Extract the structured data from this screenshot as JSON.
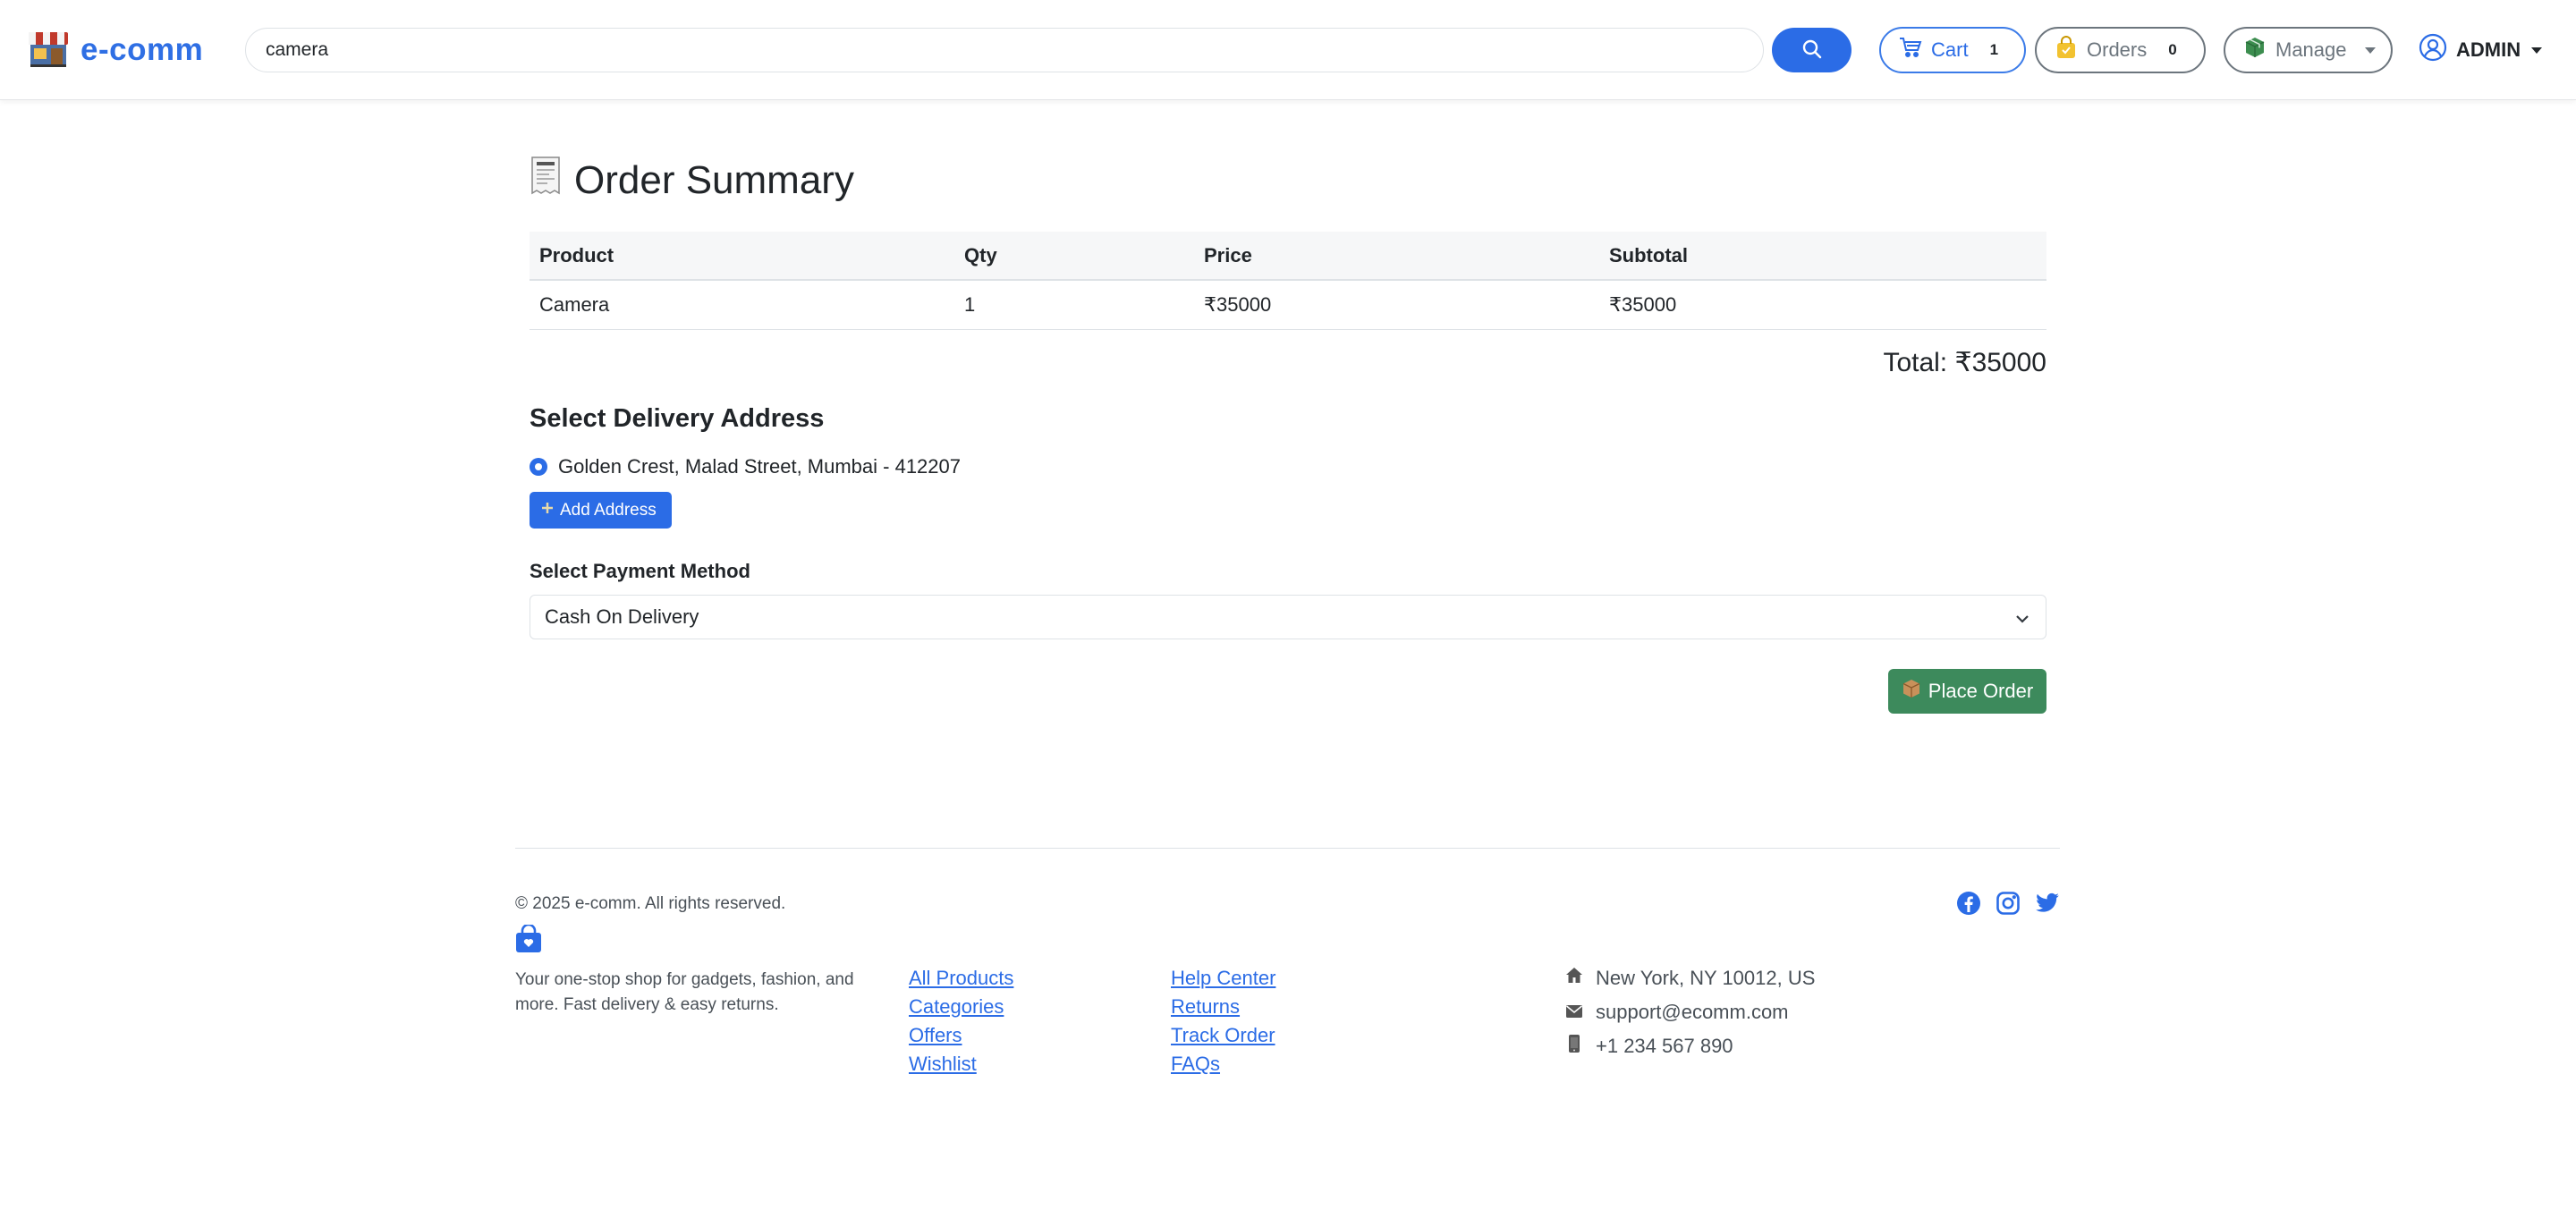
{
  "navbar": {
    "brand": "e-comm",
    "search": {
      "value": "camera",
      "placeholder": ""
    },
    "cart": {
      "label": "Cart",
      "count": "1"
    },
    "orders": {
      "label": "Orders",
      "count": "0"
    },
    "manage": {
      "label": "Manage"
    },
    "user": {
      "label": "ADMIN"
    }
  },
  "main": {
    "title": "Order Summary",
    "table": {
      "headers": [
        "Product",
        "Qty",
        "Price",
        "Subtotal"
      ],
      "rows": [
        {
          "product": "Camera",
          "qty": "1",
          "price": "₹35000",
          "subtotal": "₹35000"
        }
      ]
    },
    "total": "Total: ₹35000",
    "address_heading": "Select Delivery Address",
    "addresses": [
      {
        "text": "Golden Crest, Malad Street, Mumbai - 412207",
        "selected": true
      }
    ],
    "add_address_label": "Add Address",
    "payment_label": "Select Payment Method",
    "payment_selected": "Cash On Delivery",
    "place_order_label": "Place Order"
  },
  "footer": {
    "copyright": "© 2025 e-comm. All rights reserved.",
    "tagline": "Your one-stop shop for gadgets, fashion, and more. Fast delivery & easy returns.",
    "links_col1": [
      "All Products",
      "Categories",
      "Offers",
      "Wishlist"
    ],
    "links_col2": [
      "Help Center",
      "Returns",
      "Track Order",
      "FAQs"
    ],
    "contact": {
      "address": "New York, NY 10012, US",
      "email": "support@ecomm.com",
      "phone": "+1 234 567 890"
    },
    "social": [
      "facebook-icon",
      "instagram-icon",
      "twitter-icon"
    ]
  },
  "colors": {
    "primary": "#2b6ce6",
    "success": "#3d8a5c",
    "muted": "#6c757d"
  }
}
